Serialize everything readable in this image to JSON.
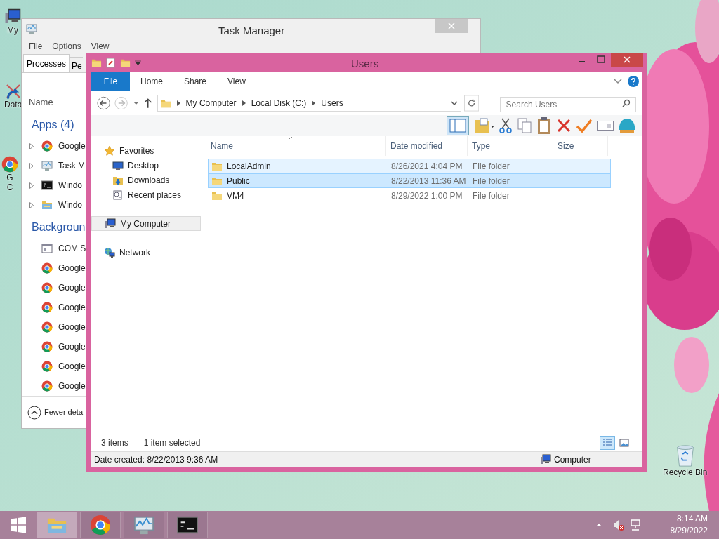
{
  "desktop_icons": [
    {
      "kind": "computer",
      "lines": [
        "My"
      ]
    },
    {
      "kind": "shortcut",
      "lines": [
        "Data"
      ]
    },
    {
      "kind": "chrome",
      "lines": [
        "G",
        "C"
      ]
    },
    {
      "kind": "recycle",
      "lines": [
        "Recycle Bin"
      ]
    }
  ],
  "task_manager": {
    "title": "Task Manager",
    "menu": [
      "File",
      "Options",
      "View"
    ],
    "tabs": [
      {
        "label": "Processes",
        "selected": true
      },
      {
        "label": "Pe",
        "selected": false
      }
    ],
    "column": "Name",
    "groups": [
      {
        "title": "Apps (4)",
        "items": [
          {
            "kind": "chrome",
            "label": "Google",
            "expandable": true
          },
          {
            "kind": "taskmgr",
            "label": "Task M",
            "expandable": true
          },
          {
            "kind": "cmd",
            "label": "Windo",
            "expandable": true
          },
          {
            "kind": "explorer",
            "label": "Windo",
            "expandable": true
          }
        ]
      },
      {
        "title": "Backgroun",
        "items": [
          {
            "kind": "com",
            "label": "COM S",
            "expandable": false
          },
          {
            "kind": "chrome",
            "label": "Google",
            "expandable": false
          },
          {
            "kind": "chrome",
            "label": "Google",
            "expandable": false
          },
          {
            "kind": "chrome",
            "label": "Google",
            "expandable": false
          },
          {
            "kind": "chrome",
            "label": "Google",
            "expandable": false
          },
          {
            "kind": "chrome",
            "label": "Google",
            "expandable": false
          },
          {
            "kind": "chrome",
            "label": "Google",
            "expandable": false
          },
          {
            "kind": "chrome",
            "label": "Google",
            "expandable": false
          }
        ]
      }
    ],
    "footer": "Fewer deta"
  },
  "explorer": {
    "title": "Users",
    "ribbon_tabs": [
      {
        "label": "File",
        "selected": true
      },
      {
        "label": "Home",
        "selected": false
      },
      {
        "label": "Share",
        "selected": false
      },
      {
        "label": "View",
        "selected": false
      }
    ],
    "breadcrumb": [
      "My Computer",
      "Local Disk (C:)",
      "Users"
    ],
    "search": {
      "placeholder": "Search Users"
    },
    "nav": [
      {
        "kind": "star",
        "label": "Favorites",
        "selected": false,
        "children": [
          {
            "kind": "desktop",
            "label": "Desktop",
            "selected": false
          },
          {
            "kind": "downloads",
            "label": "Downloads",
            "selected": false
          },
          {
            "kind": "recent",
            "label": "Recent places",
            "selected": false
          }
        ]
      },
      {
        "kind": "computer",
        "label": "My Computer",
        "selected": true
      },
      {
        "kind": "network",
        "label": "Network",
        "selected": false
      }
    ],
    "columns": [
      "Name",
      "Date modified",
      "Type",
      "Size"
    ],
    "rows": [
      {
        "name": "LocalAdmin",
        "date": "8/26/2021 4:04 PM",
        "type": "File folder",
        "selected": false,
        "hot": true
      },
      {
        "name": "Public",
        "date": "8/22/2013 11:36 AM",
        "type": "File folder",
        "selected": true,
        "hot": false
      },
      {
        "name": "VM4",
        "date": "8/29/2022 1:00 PM",
        "type": "File folder",
        "selected": false,
        "hot": false
      }
    ],
    "item_count": "3 items",
    "selection": "1 item selected",
    "views": [
      {
        "kind": "details",
        "selected": true
      },
      {
        "kind": "large",
        "selected": false
      }
    ],
    "details": "Date created: 8/22/2013 9:36 AM",
    "location": "Computer"
  },
  "taskbar": {
    "apps": [
      {
        "kind": "explorer",
        "active": true
      },
      {
        "kind": "chrome",
        "active": false
      },
      {
        "kind": "taskmgr",
        "active": false
      },
      {
        "kind": "cmd",
        "active": false
      }
    ],
    "time": "8:14 AM",
    "date": "8/29/2022"
  }
}
